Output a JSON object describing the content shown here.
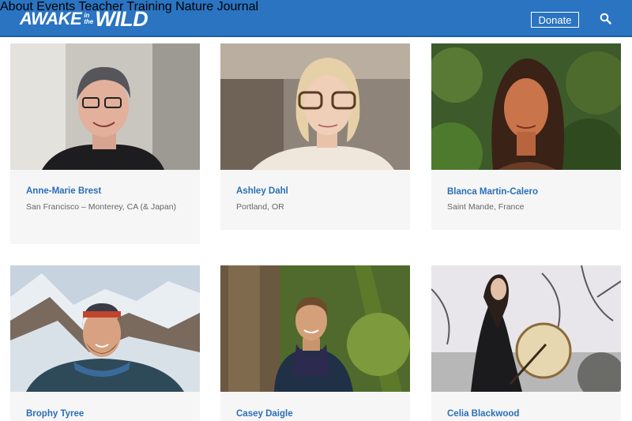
{
  "header": {
    "logo": {
      "part1": "AWAKE",
      "in": "in",
      "the": "the",
      "part2": "WILD"
    },
    "nav": [
      "About",
      "Events",
      "Teacher Training",
      "Nature Journal"
    ],
    "donate_label": "Donate",
    "search_icon": "search-icon",
    "color": "#2a74c2"
  },
  "teachers": [
    {
      "name": "Anne-Marie Brest",
      "location": "San Francisco – Monterey, CA (& Japan)"
    },
    {
      "name": "Ashley Dahl",
      "location": "Portland, OR"
    },
    {
      "name": "Blanca Martin-Calero",
      "location": "Saint Mande, France"
    },
    {
      "name": "Brophy Tyree",
      "location": ""
    },
    {
      "name": "Casey Daigle",
      "location": ""
    },
    {
      "name": "Celia Blackwood",
      "location": ""
    }
  ],
  "colors": {
    "name_link": "#2a6fb7",
    "card_bg": "#f6f6f6"
  }
}
